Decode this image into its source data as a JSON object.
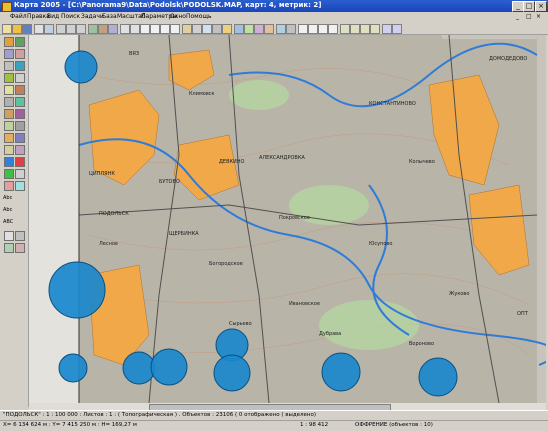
{
  "window": {
    "title": "Карта 2005 - [C:\\Panorama9\\Data\\Podolsk\\PODOLSK.MAP, карт: 4, метрик: 2]",
    "minimize": "_",
    "maximize": "□",
    "close": "×"
  },
  "menu": {
    "items": [
      "Файл",
      "Правка",
      "Вид",
      "Поиск",
      "Задачи",
      "База",
      "Масштаб",
      "Параметры",
      "Окно",
      "Помощь"
    ],
    "right_controls": [
      "_",
      "□",
      "×"
    ]
  },
  "sidebar": {
    "labels": [
      "Abc",
      "Abc",
      "ABC"
    ]
  },
  "map": {
    "labels": [
      "ВЯЗ",
      "ЦИПЛЯНК",
      "БУТОВО",
      "ДЕВКИНО",
      "АЛЕКСАНДРОВКА",
      "ЩЕРБИНКА",
      "КОНСТАНТИНОВО",
      "ДОМОДЕДОВО",
      "Покровское",
      "Богородское",
      "Колычево",
      "Юсупово",
      "Лесное",
      "Ивановское",
      "Жуково",
      "Дубрава",
      "Сырьево",
      "ОПТ",
      "ПОДОЛЬСК",
      "Климовск",
      "Вороново"
    ]
  },
  "status": {
    "line1": "\"ПОДОЛЬСК\" : 1 : 100 000 : Листов : 1 : ( Топографическая ) . Объектов : 23106 ( 0 отображено ( выделено)",
    "line2_coords": "X= 6 134 624 м : Y= 7 415 250 м : H= 169,27 м",
    "line2_scale": "1 : 98 412",
    "line2_mode": "ОФФРЕНИЕ (объектов : 10)"
  },
  "colors": {
    "titlebar": "#2a5fd0",
    "map_background": "#c8c4bc",
    "urban": "#f0a848",
    "water": "#2f7bd8",
    "green": "#20a040",
    "road": "#606060",
    "circle_fill": "#1a88cc",
    "circle_stroke": "#0a4f80"
  }
}
